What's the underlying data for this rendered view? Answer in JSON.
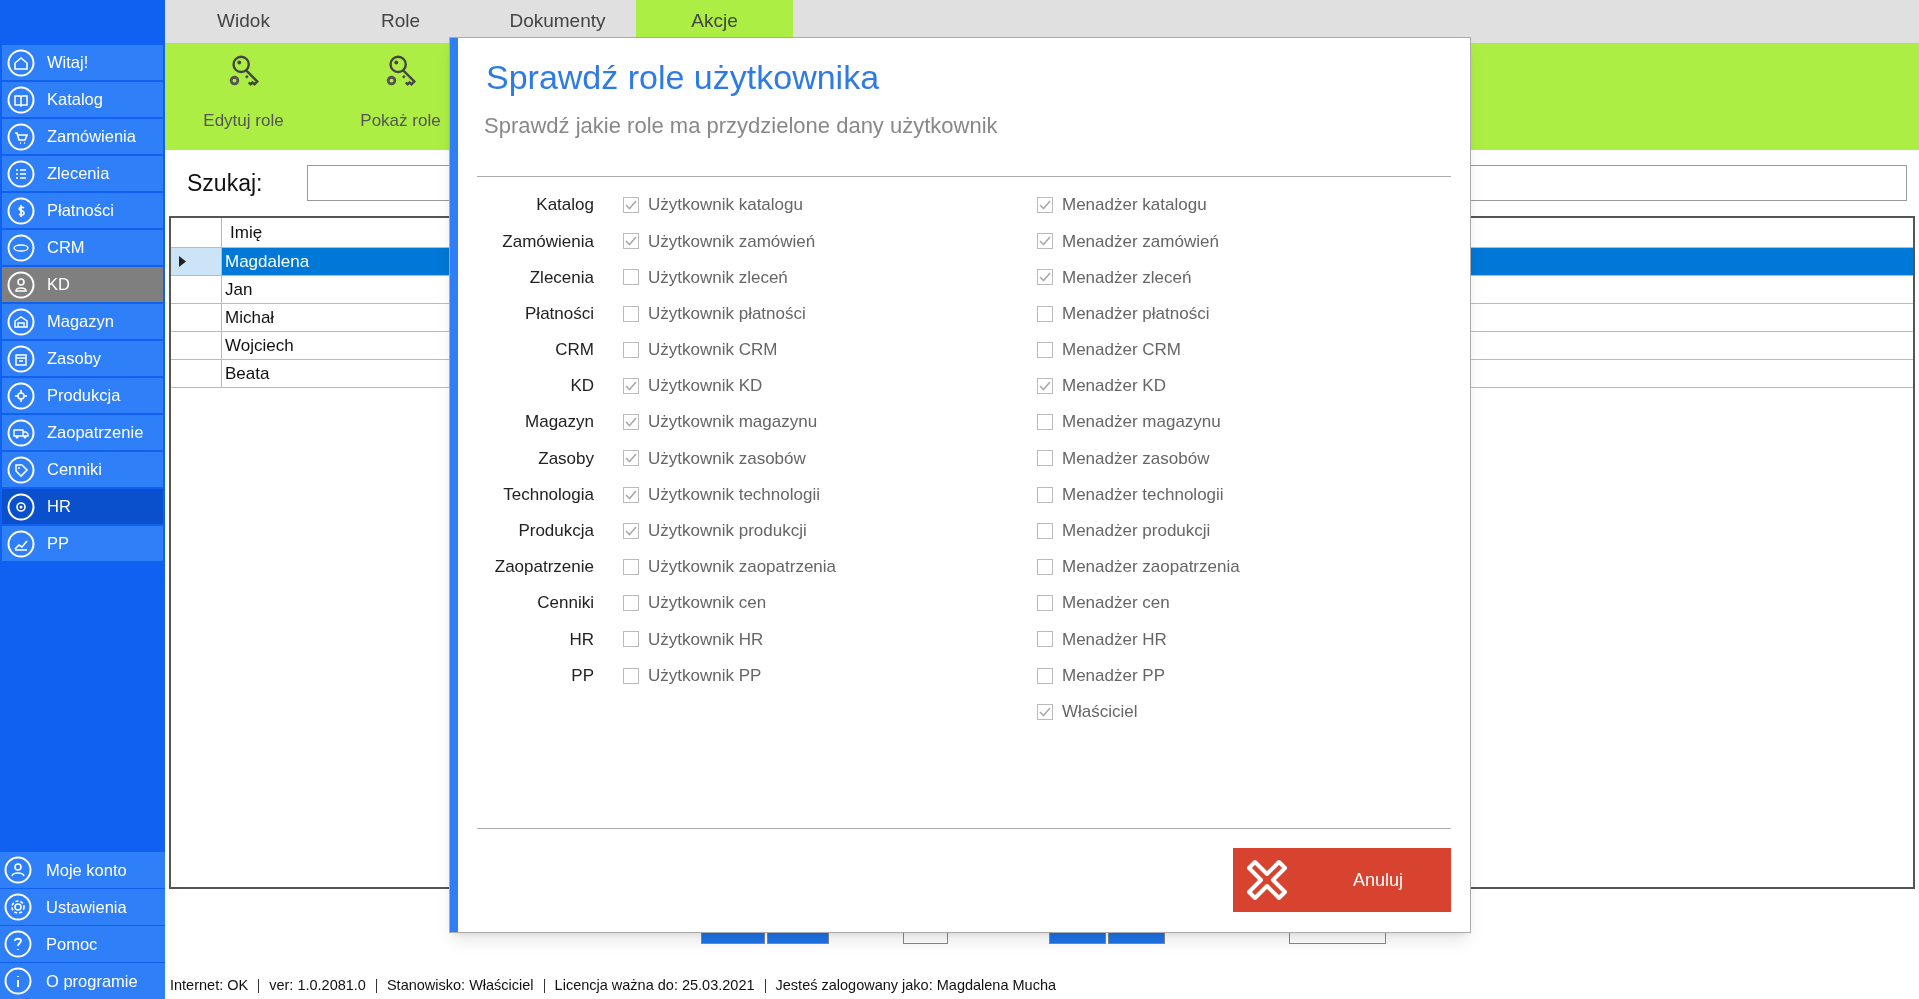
{
  "sidebar": {
    "items": [
      {
        "label": "Witaj!",
        "selected": false,
        "hovered": false
      },
      {
        "label": "Katalog",
        "selected": false,
        "hovered": false
      },
      {
        "label": "Zamówienia",
        "selected": false,
        "hovered": false
      },
      {
        "label": "Zlecenia",
        "selected": false,
        "hovered": false
      },
      {
        "label": "Płatności",
        "selected": false,
        "hovered": false
      },
      {
        "label": "CRM",
        "selected": false,
        "hovered": false
      },
      {
        "label": "KD",
        "selected": true,
        "hovered": false
      },
      {
        "label": "Magazyn",
        "selected": false,
        "hovered": false
      },
      {
        "label": "Zasoby",
        "selected": false,
        "hovered": false
      },
      {
        "label": "Produkcja",
        "selected": false,
        "hovered": false
      },
      {
        "label": "Zaopatrzenie",
        "selected": false,
        "hovered": false
      },
      {
        "label": "Cenniki",
        "selected": false,
        "hovered": false
      },
      {
        "label": "HR",
        "selected": false,
        "hovered": true
      },
      {
        "label": "PP",
        "selected": false,
        "hovered": false
      }
    ],
    "bottom_items": [
      {
        "label": "Moje konto"
      },
      {
        "label": "Ustawienia"
      },
      {
        "label": "Pomoc"
      },
      {
        "label": "O programie"
      }
    ]
  },
  "tabs": [
    {
      "label": "Widok",
      "selected": false
    },
    {
      "label": "Role",
      "selected": false
    },
    {
      "label": "Dokumenty",
      "selected": false
    },
    {
      "label": "Akcje",
      "selected": true
    }
  ],
  "ribbon": [
    {
      "label": "Edytuj role"
    },
    {
      "label": "Pokaż role"
    }
  ],
  "search": {
    "label": "Szukaj:"
  },
  "table": {
    "columns": [
      "Imię"
    ],
    "rows": [
      {
        "name": "Magdalena",
        "selected": true
      },
      {
        "name": "Jan",
        "selected": false
      },
      {
        "name": "Michał",
        "selected": false
      },
      {
        "name": "Wojciech",
        "selected": false
      },
      {
        "name": "Beata",
        "selected": false
      }
    ]
  },
  "dialog": {
    "title": "Sprawdź role użytkownika",
    "subtitle": "Sprawdź jakie role ma przydzielone dany użytkownik",
    "roles": [
      {
        "module": "Katalog",
        "user": {
          "label": "Użytkownik katalogu",
          "checked": true
        },
        "manager": {
          "label": "Menadżer katalogu",
          "checked": true
        }
      },
      {
        "module": "Zamówienia",
        "user": {
          "label": "Użytkownik zamówień",
          "checked": true
        },
        "manager": {
          "label": "Menadżer zamówień",
          "checked": true
        }
      },
      {
        "module": "Zlecenia",
        "user": {
          "label": "Użytkownik zleceń",
          "checked": false
        },
        "manager": {
          "label": "Menadżer zleceń",
          "checked": true
        }
      },
      {
        "module": "Płatności",
        "user": {
          "label": "Użytkownik płatności",
          "checked": false
        },
        "manager": {
          "label": "Menadżer płatności",
          "checked": false
        }
      },
      {
        "module": "CRM",
        "user": {
          "label": "Użytkownik CRM",
          "checked": false
        },
        "manager": {
          "label": "Menadżer CRM",
          "checked": false
        }
      },
      {
        "module": "KD",
        "user": {
          "label": "Użytkownik KD",
          "checked": true
        },
        "manager": {
          "label": "Menadżer KD",
          "checked": true
        }
      },
      {
        "module": "Magazyn",
        "user": {
          "label": "Użytkownik magazynu",
          "checked": true
        },
        "manager": {
          "label": "Menadżer magazynu",
          "checked": false
        }
      },
      {
        "module": "Zasoby",
        "user": {
          "label": "Użytkownik zasobów",
          "checked": true
        },
        "manager": {
          "label": "Menadżer zasobów",
          "checked": false
        }
      },
      {
        "module": "Technologia",
        "user": {
          "label": "Użytkownik technologii",
          "checked": true
        },
        "manager": {
          "label": "Menadżer technologii",
          "checked": false
        }
      },
      {
        "module": "Produkcja",
        "user": {
          "label": "Użytkownik produkcji",
          "checked": true
        },
        "manager": {
          "label": "Menadżer produkcji",
          "checked": false
        }
      },
      {
        "module": "Zaopatrzenie",
        "user": {
          "label": "Użytkownik zaopatrzenia",
          "checked": false
        },
        "manager": {
          "label": "Menadżer zaopatrzenia",
          "checked": false
        }
      },
      {
        "module": "Cenniki",
        "user": {
          "label": "Użytkownik cen",
          "checked": false
        },
        "manager": {
          "label": "Menadżer cen",
          "checked": false
        }
      },
      {
        "module": "HR",
        "user": {
          "label": "Użytkownik HR",
          "checked": false
        },
        "manager": {
          "label": "Menadżer HR",
          "checked": false
        }
      },
      {
        "module": "PP",
        "user": {
          "label": "Użytkownik PP",
          "checked": false
        },
        "manager": {
          "label": "Menadżer PP",
          "checked": false
        }
      }
    ],
    "owner": {
      "label": "Właściciel",
      "checked": true
    },
    "cancel": "Anuluj"
  },
  "status_bar": [
    "Internet: OK",
    "ver: 1.0.2081.0",
    "Stanowisko: Właściciel",
    "Licencja ważna do: 25.03.2021",
    "Jesteś zalogowany jako: Magdalena Mucha"
  ]
}
